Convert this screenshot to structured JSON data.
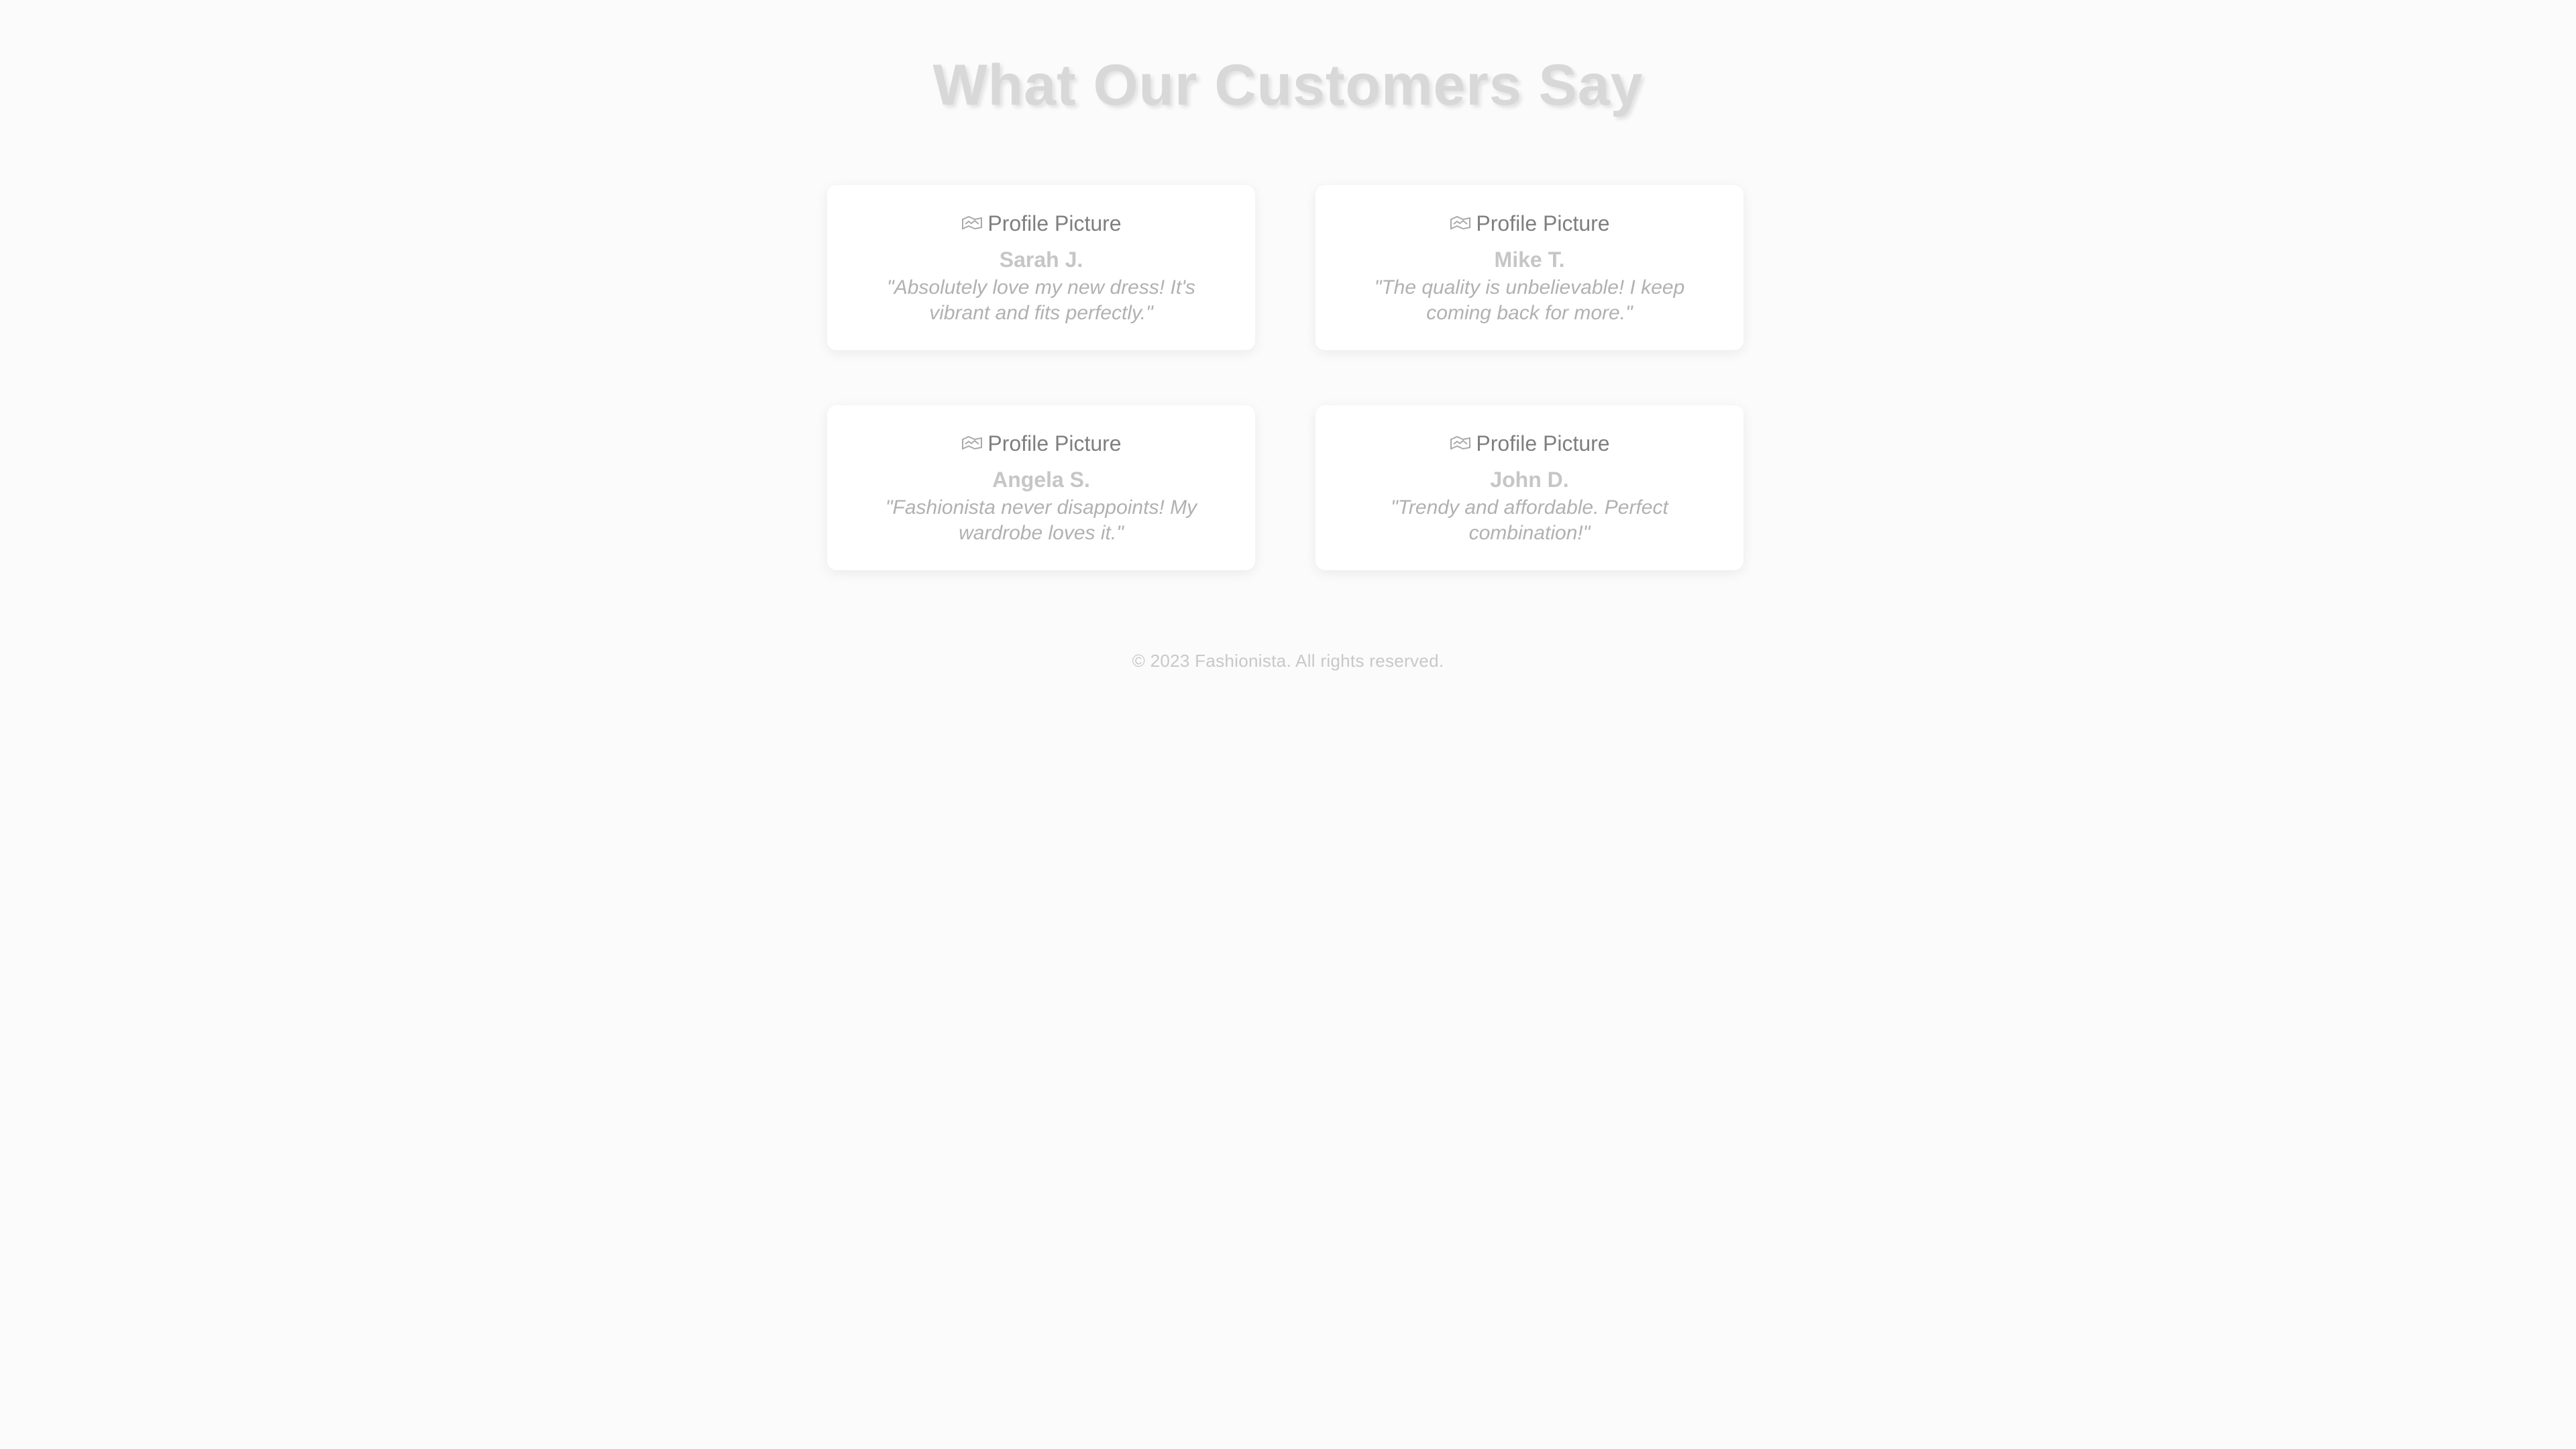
{
  "page": {
    "title": "What Our Customers Say"
  },
  "testimonials": [
    {
      "image_alt": "Profile Picture",
      "name": "Sarah J.",
      "quote": "\"Absolutely love my new dress! It's vibrant and fits perfectly.\""
    },
    {
      "image_alt": "Profile Picture",
      "name": "Mike T.",
      "quote": "\"The quality is unbelievable! I keep coming back for more.\""
    },
    {
      "image_alt": "Profile Picture",
      "name": "Angela S.",
      "quote": "\"Fashionista never disappoints! My wardrobe loves it.\""
    },
    {
      "image_alt": "Profile Picture",
      "name": "John D.",
      "quote": "\"Trendy and affordable. Perfect combination!\""
    }
  ],
  "footer": {
    "text": "© 2023 Fashionista. All rights reserved."
  },
  "icons": {
    "profile_picture": "broken-image-icon"
  },
  "colors": {
    "background": "#fbfbfb",
    "card": "#ffffff",
    "title": "#d8d8d8",
    "text": "#b1b1b1"
  }
}
